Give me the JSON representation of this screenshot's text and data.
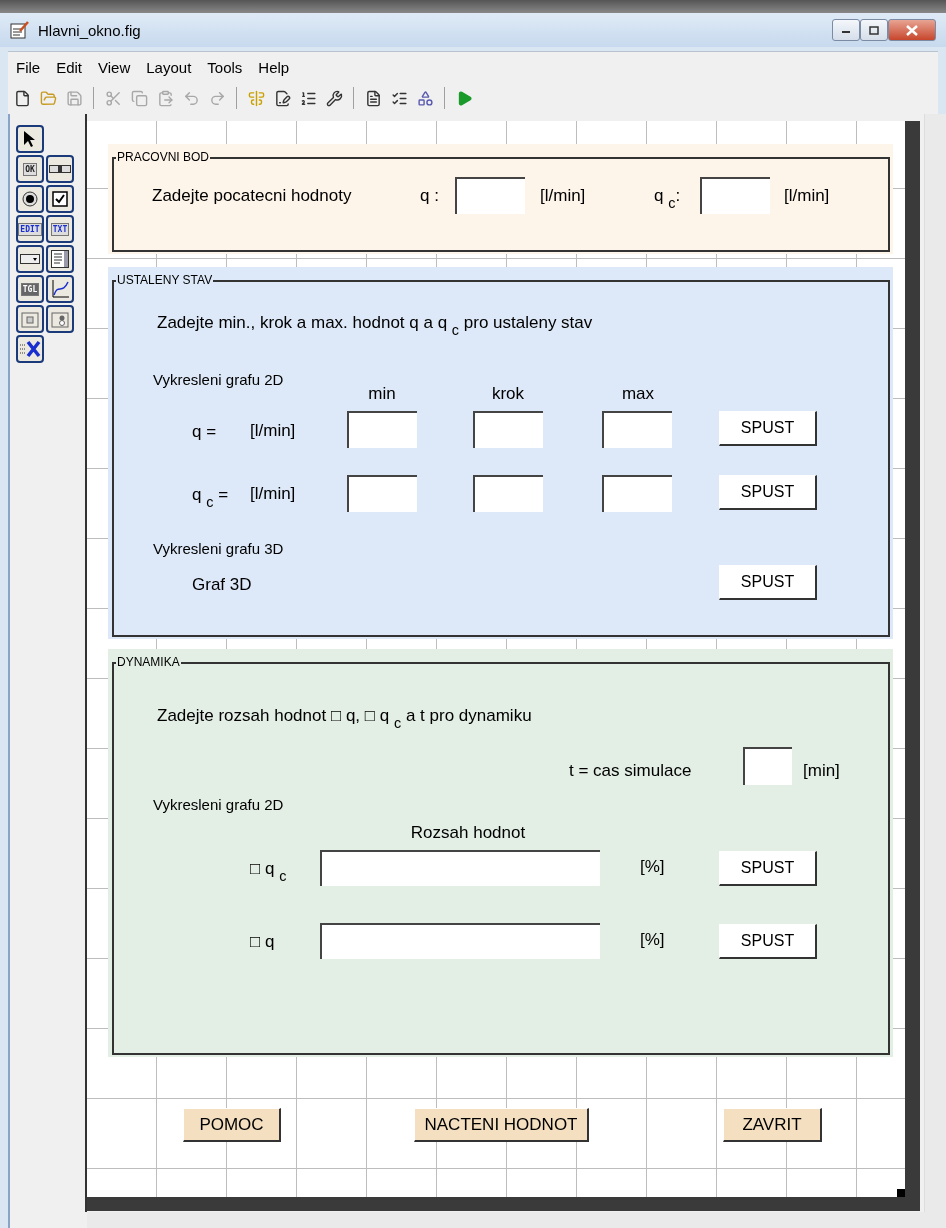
{
  "window": {
    "title": "Hlavni_okno.fig"
  },
  "menu": [
    "File",
    "Edit",
    "View",
    "Layout",
    "Tools",
    "Help"
  ],
  "toolbar": [
    {
      "kind": "new",
      "disabled": false
    },
    {
      "kind": "open",
      "disabled": false
    },
    {
      "kind": "save",
      "disabled": true
    },
    {
      "kind": "sep"
    },
    {
      "kind": "cut",
      "disabled": true
    },
    {
      "kind": "copy",
      "disabled": true
    },
    {
      "kind": "paste",
      "disabled": true
    },
    {
      "kind": "undo",
      "disabled": true
    },
    {
      "kind": "redo",
      "disabled": true
    },
    {
      "kind": "sep"
    },
    {
      "kind": "align",
      "disabled": false
    },
    {
      "kind": "menu-editor",
      "disabled": false
    },
    {
      "kind": "tab-order",
      "disabled": false
    },
    {
      "kind": "toolbar-editor",
      "disabled": false
    },
    {
      "kind": "sep"
    },
    {
      "kind": "mfile",
      "disabled": false
    },
    {
      "kind": "inspector",
      "disabled": false
    },
    {
      "kind": "browser",
      "disabled": false
    },
    {
      "kind": "sep"
    },
    {
      "kind": "run",
      "disabled": false
    }
  ],
  "palette": [
    {
      "kind": "pointer"
    },
    {
      "kind": "button",
      "label": "OK"
    },
    {
      "kind": "slider"
    },
    {
      "kind": "radio"
    },
    {
      "kind": "checkbox"
    },
    {
      "kind": "edit",
      "label": "EDIT"
    },
    {
      "kind": "text",
      "label": "TXT"
    },
    {
      "kind": "popup"
    },
    {
      "kind": "listbox"
    },
    {
      "kind": "toggle",
      "label": "TGL"
    },
    {
      "kind": "axes"
    },
    {
      "kind": "panel"
    },
    {
      "kind": "group"
    },
    {
      "kind": "activex"
    }
  ],
  "pracovni_bod": {
    "title": "PRACOVNI BOD",
    "prompt": "Zadejte pocatecni hodnoty",
    "inputs": [
      {
        "label": "q :",
        "unit": "[l/min]"
      },
      {
        "label": "q $_{c}$:",
        "unit": "[l/min]"
      }
    ]
  },
  "ustaleny_stav": {
    "title": "USTALENY STAV",
    "prompt": "Zadejte min., krok a max. hodnot q a q $_{c}$ pro ustaleny stav",
    "section_2d": "Vykresleni grafu 2D",
    "columns": [
      "min",
      "krok",
      "max"
    ],
    "rows": [
      {
        "label": "q =",
        "unit": "[l/min]",
        "button": "SPUST"
      },
      {
        "label": "q $_{c}$ =",
        "unit": "[l/min]",
        "button": "SPUST"
      }
    ],
    "section_3d": "Vykresleni grafu 3D",
    "row_3d": {
      "label": "Graf 3D",
      "button": "SPUST"
    }
  },
  "dynamika": {
    "title": "DYNAMIKA",
    "prompt": "Zadejte rozsah hodnot □ q, □ q $_{c}$ a t pro dynamiku",
    "time": {
      "label": "t = cas simulace",
      "unit": "[min]"
    },
    "section_2d": "Vykresleni grafu 2D",
    "range_heading": "Rozsah hodnot",
    "rows": [
      {
        "label": "□ q $_{c}$",
        "unit": "[%]",
        "button": "SPUST"
      },
      {
        "label": "□ q",
        "unit": "[%]",
        "button": "SPUST"
      }
    ]
  },
  "buttons": [
    "POMOC",
    "NACTENI HODNOT",
    "ZAVRIT"
  ]
}
